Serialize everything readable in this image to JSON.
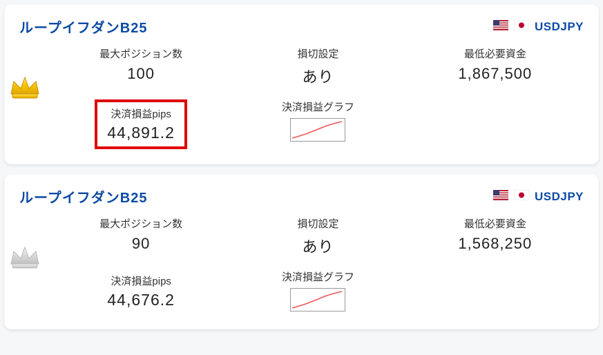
{
  "cards": [
    {
      "title": "ループイフダンB25",
      "pair": "USDJPY",
      "crown_rank": 1,
      "stats": {
        "max_positions_label": "最大ポジション数",
        "max_positions_value": "100",
        "stoploss_label": "損切設定",
        "stoploss_value": "あり",
        "min_funds_label": "最低必要資金",
        "min_funds_value": "1,867,500"
      },
      "pips": {
        "label": "決済損益pips",
        "value": "44,891.2",
        "highlighted": true
      },
      "graph_label": "決済損益グラフ"
    },
    {
      "title": "ループイフダンB25",
      "pair": "USDJPY",
      "crown_rank": 2,
      "stats": {
        "max_positions_label": "最大ポジション数",
        "max_positions_value": "90",
        "stoploss_label": "損切設定",
        "stoploss_value": "あり",
        "min_funds_label": "最低必要資金",
        "min_funds_value": "1,568,250"
      },
      "pips": {
        "label": "決済損益pips",
        "value": "44,676.2",
        "highlighted": false
      },
      "graph_label": "決済損益グラフ"
    }
  ]
}
